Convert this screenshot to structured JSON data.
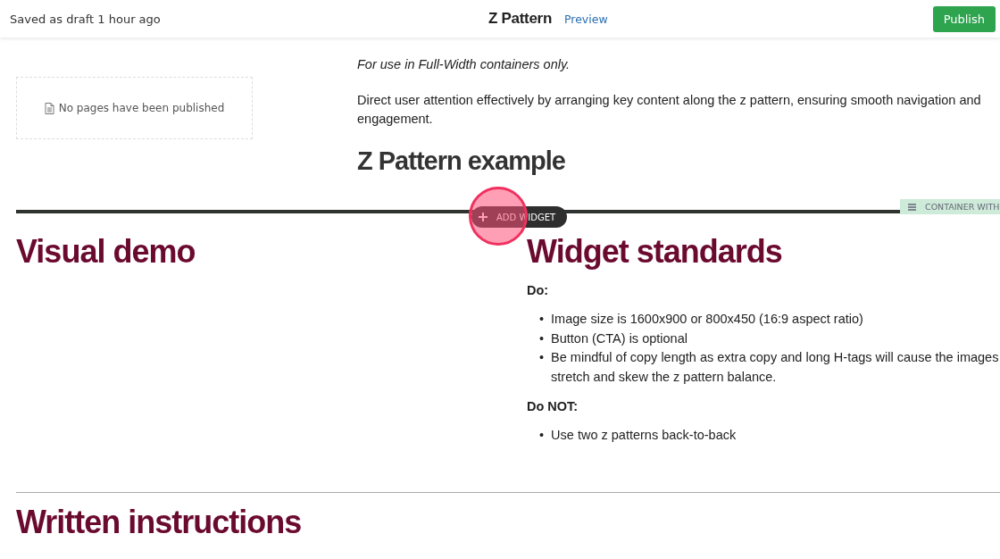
{
  "header": {
    "status": "Saved as draft 1 hour ago",
    "title": "Z Pattern",
    "preview_link": "Preview",
    "publish_button": "Publish"
  },
  "sidebar": {
    "empty_message": "No pages have been published"
  },
  "intro": {
    "note": "For use in Full-Width containers only.",
    "description": "Direct user attention effectively by arranging key content along the z pattern, ensuring smooth navigation and engagement.",
    "heading": "Z Pattern example"
  },
  "add_widget": {
    "label": "ADD WIDGET"
  },
  "container_tag": {
    "label": "CONTAINER WITH"
  },
  "left_column": {
    "heading": "Visual demo"
  },
  "right_column": {
    "heading": "Widget standards",
    "sections": [
      {
        "title": "Do:",
        "marker": "•",
        "items": [
          [
            "Image size is 1600x900 or 800x450 (16:9 aspect ratio)"
          ],
          [
            "Button (CTA) is optional"
          ],
          [
            "Be mindful of copy length as extra copy and long H-tags will cause the images",
            "stretch and skew the z pattern balance."
          ]
        ]
      },
      {
        "title": "Do NOT:",
        "marker": "•",
        "items": [
          [
            "Use two z patterns back-to-back"
          ]
        ]
      }
    ]
  },
  "next_section": {
    "heading": "Written instructions"
  }
}
